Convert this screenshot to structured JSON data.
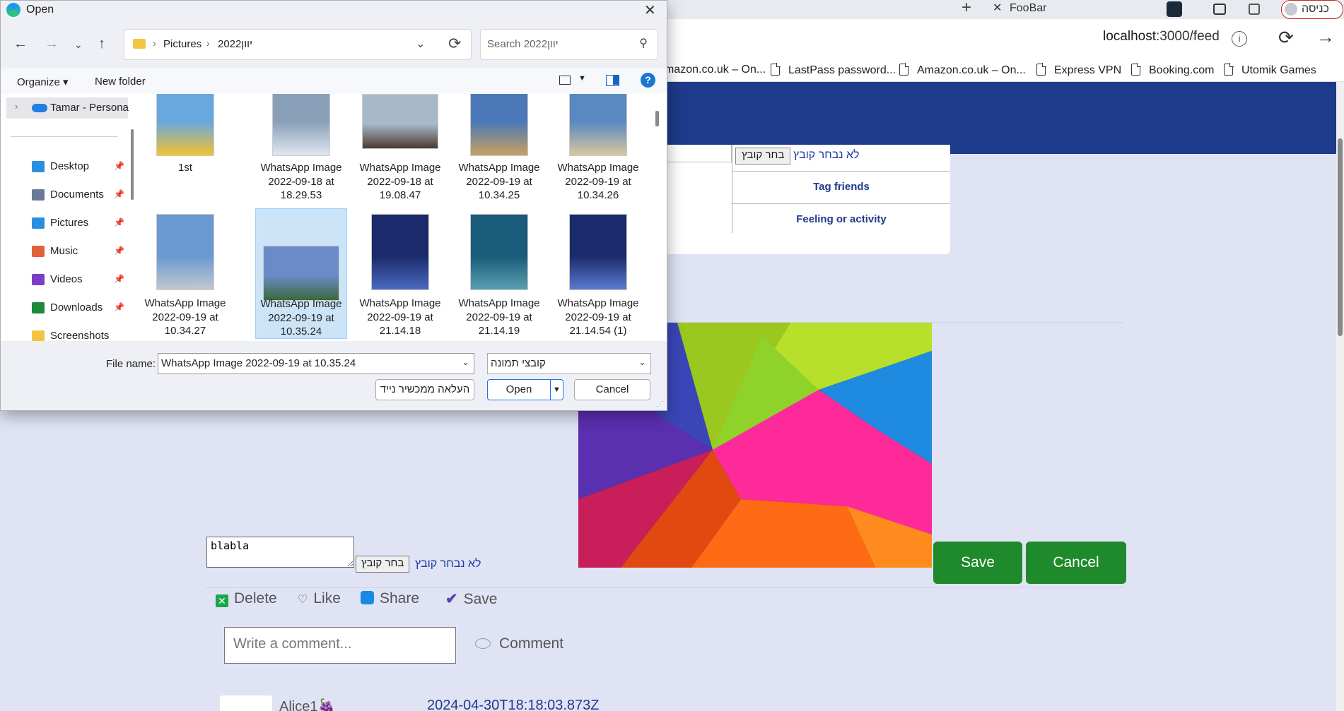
{
  "browser": {
    "tab": {
      "close_glyph": "✕",
      "title": "FooBar"
    },
    "new_tab_glyph": "+",
    "profile_label": "כניסה",
    "url_host": "localhost",
    "url_path": ":3000/feed",
    "bookmarks": [
      "mazon.co.uk – On...",
      "LastPass password...",
      "Amazon.co.uk – On...",
      "Express VPN",
      "Booking.com",
      "Utomik Games"
    ]
  },
  "post_card": {
    "file_button": "בחר קובץ",
    "no_file": "לא נבחר קובץ",
    "tag_friends": "Tag friends",
    "feeling": "Feeling or activity"
  },
  "edit": {
    "textarea_value": "blabla",
    "file_button": "בחר קובץ",
    "no_file": "לא נבחר קובץ",
    "save": "Save",
    "cancel": "Cancel"
  },
  "actions": {
    "delete": "Delete",
    "like": "Like",
    "share": "Share",
    "save": "Save",
    "comment_placeholder": "Write a comment...",
    "comment_button": "Comment"
  },
  "author": {
    "name": "Alice1",
    "emoji": "🍇",
    "date": "2024-04-30T18:18:03.873Z"
  },
  "dialog": {
    "title": "Open",
    "close_glyph": "✕",
    "path": [
      "Pictures",
      "2022יוון"
    ],
    "search_placeholder": "Search 2022יוון",
    "organize": "Organize ▾",
    "new_folder": "New folder",
    "help": "?",
    "sidebar": {
      "onedrive": "Tamar - Persona",
      "items": [
        {
          "label": "Desktop",
          "icon": "desktop-icon",
          "color": "#2b8fe0"
        },
        {
          "label": "Documents",
          "icon": "documents-icon",
          "color": "#6a7a9a"
        },
        {
          "label": "Pictures",
          "icon": "pictures-icon",
          "color": "#2b8fe0"
        },
        {
          "label": "Music",
          "icon": "music-icon",
          "color": "#e0613a"
        },
        {
          "label": "Videos",
          "icon": "videos-icon",
          "color": "#7a3ec8"
        },
        {
          "label": "Downloads",
          "icon": "downloads-icon",
          "color": "#1b8a3a"
        },
        {
          "label": "Screenshots",
          "icon": "folder-icon",
          "color": "#f4c542"
        }
      ]
    },
    "files": [
      {
        "lines": [
          "1st"
        ],
        "selected": false
      },
      {
        "lines": [
          "WhatsApp Image",
          "2022-09-18 at",
          "18.29.53"
        ],
        "selected": false
      },
      {
        "lines": [
          "WhatsApp Image",
          "2022-09-18 at",
          "19.08.47"
        ],
        "selected": false
      },
      {
        "lines": [
          "WhatsApp Image",
          "2022-09-19 at",
          "10.34.25"
        ],
        "selected": false
      },
      {
        "lines": [
          "WhatsApp Image",
          "2022-09-19 at",
          "10.34.26"
        ],
        "selected": false
      },
      {
        "lines": [
          "WhatsApp Image",
          "2022-09-19 at",
          "10.34.27"
        ],
        "selected": false
      },
      {
        "lines": [
          "WhatsApp Image",
          "2022-09-19 at",
          "10.35.24"
        ],
        "selected": true
      },
      {
        "lines": [
          "WhatsApp Image",
          "2022-09-19 at",
          "21.14.18"
        ],
        "selected": false
      },
      {
        "lines": [
          "WhatsApp Image",
          "2022-09-19 at",
          "21.14.19"
        ],
        "selected": false
      },
      {
        "lines": [
          "WhatsApp Image",
          "2022-09-19 at",
          "21.14.54 (1)"
        ],
        "selected": false
      }
    ],
    "file_name_label": "File name:",
    "file_name_value": "WhatsApp Image 2022-09-19 at 10.35.24",
    "file_type": "קובצי תמונה",
    "upload_button": "העלאה ממכשיר נייד",
    "open_button": "Open",
    "cancel_button": "Cancel"
  }
}
